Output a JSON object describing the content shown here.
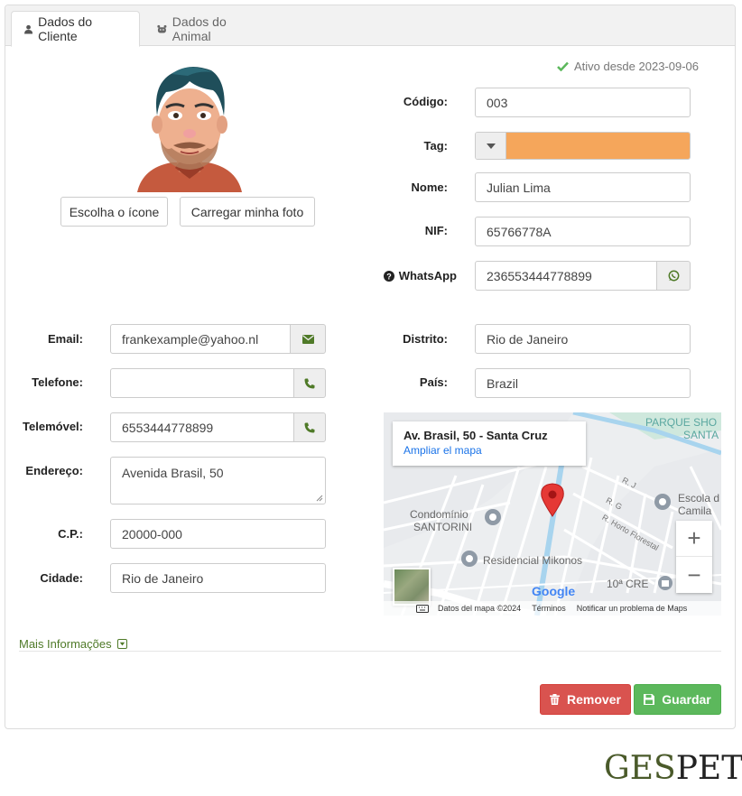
{
  "tabs": [
    {
      "label": "Dados do Cliente",
      "icon": "user-icon",
      "active": true
    },
    {
      "label": "Dados do Animal",
      "icon": "paw-icon",
      "active": false
    }
  ],
  "status": {
    "text": "Ativo desde 2023-09-06",
    "icon": "check-icon",
    "color": "#5cb85c"
  },
  "avatar": {
    "choose_icon_label": "Escolha o ícone",
    "upload_label": "Carregar minha foto"
  },
  "form": {
    "codigo": {
      "label": "Código:",
      "value": "003"
    },
    "tag": {
      "label": "Tag:",
      "color": "#f5a65b"
    },
    "nome": {
      "label": "Nome:",
      "value": "Julian Lima"
    },
    "nif": {
      "label": "NIF:",
      "value": "65766778A"
    },
    "whatsapp": {
      "label": "WhatsApp",
      "value": "236553444778899"
    },
    "email": {
      "label": "Email:",
      "value": "frankexample@yahoo.nl"
    },
    "telefone": {
      "label": "Telefone:",
      "value": ""
    },
    "telemovel": {
      "label": "Telemóvel:",
      "value": "6553444778899"
    },
    "endereco": {
      "label": "Endereço:",
      "value": "Avenida Brasil, 50"
    },
    "cp": {
      "label": "C.P.:",
      "value": "20000-000"
    },
    "cidade": {
      "label": "Cidade:",
      "value": "Rio de Janeiro"
    },
    "distrito": {
      "label": "Distrito:",
      "value": "Rio de Janeiro"
    },
    "pais": {
      "label": "País:",
      "value": "Brazil"
    }
  },
  "map": {
    "address": "Av. Brasil, 50 - Santa Cruz",
    "link": "Ampliar el mapa",
    "labels": {
      "park": "PARQUE SHO",
      "santa": "SANTA",
      "condominio": "Condomínio",
      "santorini": "SANTORINI",
      "residencial": "Residencial Mikonos",
      "escola": "Escola d",
      "camila": "Camila",
      "street_j": "R. J",
      "street_g": "R. G",
      "horto": "R. Horto Florestal",
      "cre": "10ª CRE",
      "google": "Google"
    },
    "zoom_in": "+",
    "zoom_out": "−",
    "footer": {
      "data": "Datos del mapa ©2024",
      "terms": "Términos",
      "report": "Notificar un problema de Maps"
    }
  },
  "more_info": "Mais Informações",
  "actions": {
    "remove": "Remover",
    "save": "Guardar"
  },
  "colors": {
    "danger": "#d9534f",
    "success": "#5cb85c",
    "accent_green": "#4f7a28"
  },
  "brand": {
    "part1": "GES",
    "part2": "PET"
  }
}
